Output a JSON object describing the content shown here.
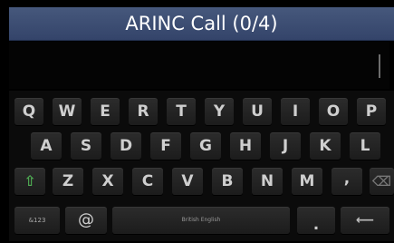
{
  "header": {
    "title": "ARINC Call (0/4)"
  },
  "keyboard": {
    "row1": [
      "Q",
      "W",
      "E",
      "R",
      "T",
      "Y",
      "U",
      "I",
      "O",
      "P"
    ],
    "row2": [
      "A",
      "S",
      "D",
      "F",
      "G",
      "H",
      "J",
      "K",
      "L"
    ],
    "row3": [
      "Z",
      "X",
      "C",
      "V",
      "B",
      "N",
      "M",
      ","
    ],
    "symbols_label": "&123",
    "at_label": "@",
    "space_label": "British English",
    "period_label": ".",
    "shift_glyph": "⇧",
    "backspace_glyph": "⌫",
    "enter_glyph": "⟵"
  }
}
